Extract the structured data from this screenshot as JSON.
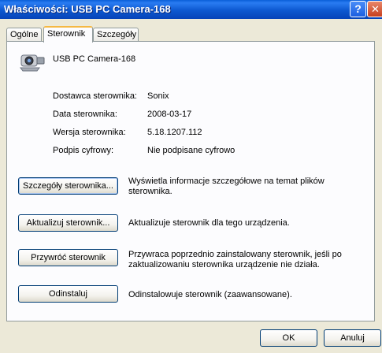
{
  "window": {
    "title": "Właściwości: USB PC Camera-168",
    "help_symbol": "?",
    "close_symbol": "✕"
  },
  "tabs": [
    {
      "label": "Ogólne",
      "active": false
    },
    {
      "label": "Sterownik",
      "active": true
    },
    {
      "label": "Szczegóły",
      "active": false
    }
  ],
  "device": {
    "name": "USB PC Camera-168",
    "icon": "webcam-icon"
  },
  "driver_info": [
    {
      "label": "Dostawca sterownika:",
      "value": "Sonix"
    },
    {
      "label": "Data sterownika:",
      "value": "2008-03-17"
    },
    {
      "label": "Wersja sterownika:",
      "value": "5.18.1207.112"
    },
    {
      "label": "Podpis cyfrowy:",
      "value": "Nie podpisane cyfrowo"
    }
  ],
  "actions": [
    {
      "button": "Szczegóły sterownika...",
      "description": "Wyświetla informacje szczegółowe na temat plików sterownika."
    },
    {
      "button": "Aktualizuj sterownik...",
      "description": "Aktualizuje sterownik dla tego urządzenia."
    },
    {
      "button": "Przywróć sterownik",
      "description": "Przywraca poprzednio zainstalowany sterownik, jeśli po zaktualizowaniu sterownika urządzenie nie działa."
    },
    {
      "button": "Odinstaluj",
      "description": "Odinstalowuje sterownik (zaawansowane)."
    }
  ],
  "footer": {
    "ok_label": "OK",
    "cancel_label": "Anuluj"
  }
}
